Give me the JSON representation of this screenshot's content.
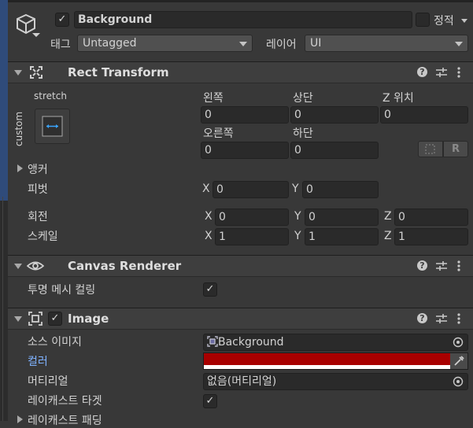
{
  "gameobject": {
    "active": true,
    "name": "Background",
    "static_label": "정적",
    "static_checked": false,
    "tag_label": "태그",
    "tag_value": "Untagged",
    "layer_label": "레이어",
    "layer_value": "UI"
  },
  "rect_transform": {
    "title": "Rect Transform",
    "anchor_preset_h": "stretch",
    "anchor_preset_v": "custom",
    "left_label": "왼쪽",
    "top_label": "상단",
    "posz_label": "Z 위치",
    "left_value": "0",
    "top_value": "0",
    "posz_value": "0",
    "right_label": "오른쪽",
    "bottom_label": "하단",
    "right_value": "0",
    "bottom_value": "0",
    "anchors_label": "앵커",
    "pivot_label": "피벗",
    "pivot": {
      "x": "0",
      "y": "0"
    },
    "rotation_label": "회전",
    "rotation": {
      "x": "0",
      "y": "0",
      "z": "0"
    },
    "scale_label": "스케일",
    "scale": {
      "x": "1",
      "y": "1",
      "z": "1"
    },
    "blueprint_btn": "R",
    "axis_x": "X",
    "axis_y": "Y",
    "axis_z": "Z"
  },
  "canvas_renderer": {
    "title": "Canvas Renderer",
    "cull_label": "투명 메시 컬링",
    "cull_checked": true
  },
  "image": {
    "title": "Image",
    "enabled": true,
    "source_label": "소스 이미지",
    "source_value": "Background",
    "color_label": "컬러",
    "color_value": "#a80000",
    "material_label": "머티리얼",
    "material_value": "없음(머티리얼)",
    "raycast_target_label": "레이캐스트 타겟",
    "raycast_target_checked": true,
    "raycast_padding_label": "레이캐스트 패딩"
  },
  "icons": {
    "help": "help-icon",
    "presets": "presets-icon",
    "menu": "kebab-menu-icon",
    "checkmark": "✓"
  }
}
